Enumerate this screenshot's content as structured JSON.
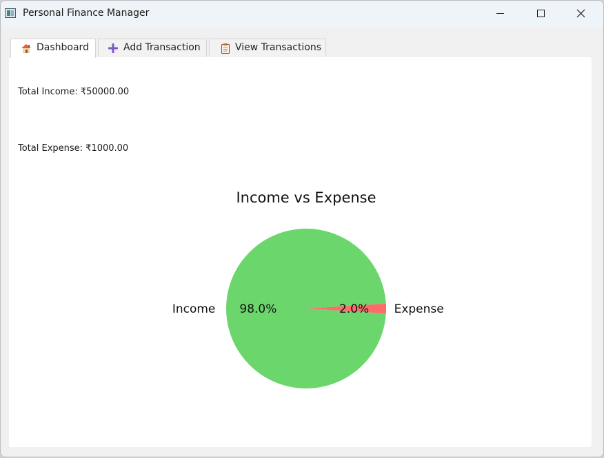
{
  "window": {
    "title": "Personal Finance Manager"
  },
  "tabs": [
    {
      "label": "Dashboard",
      "icon": "house-icon",
      "active": true
    },
    {
      "label": "Add Transaction",
      "icon": "plus-icon",
      "active": false
    },
    {
      "label": "View Transactions",
      "icon": "clipboard-icon",
      "active": false
    }
  ],
  "dashboard": {
    "total_income": "Total Income: ₹50000.00",
    "total_expense": "Total Expense: ₹1000.00"
  },
  "colors": {
    "income": "#6bd66b",
    "expense": "#ff6b6b",
    "plus_icon": "#7e57c2"
  },
  "chart_data": {
    "type": "pie",
    "title": "Income vs Expense",
    "categories": [
      "Income",
      "Expense"
    ],
    "values": [
      50000,
      1000
    ],
    "percent_labels": [
      "98.0%",
      "2.0%"
    ],
    "colors": [
      "#6bd66b",
      "#ff6b6b"
    ]
  }
}
